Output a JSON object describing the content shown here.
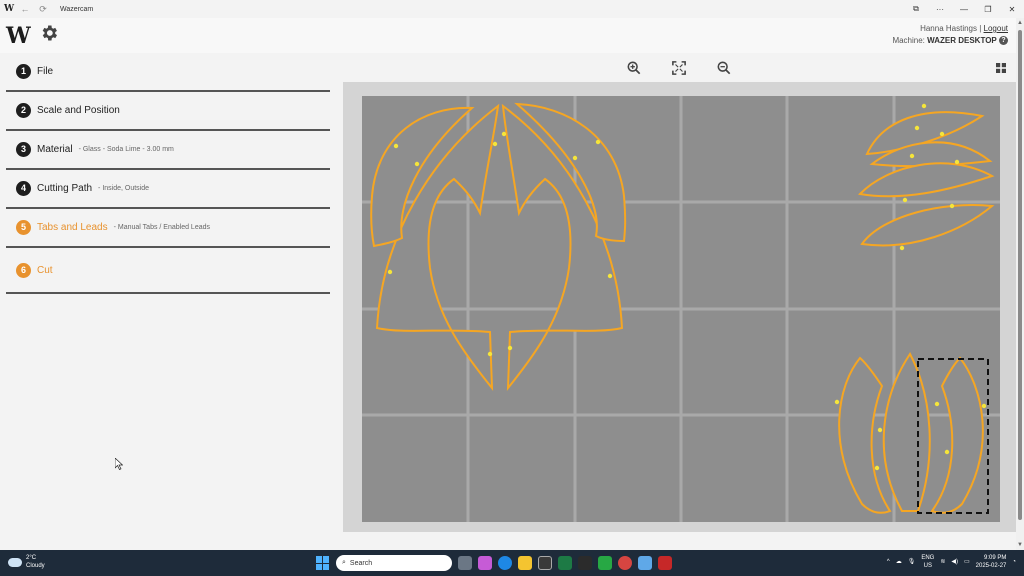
{
  "window": {
    "title": "Wazercam",
    "controls": [
      "⧉",
      "···",
      "—",
      "❐",
      "✕"
    ]
  },
  "header": {
    "logo": "W",
    "user_name": "Hanna Hastings",
    "separator": " | ",
    "logout": "Logout",
    "machine_label": "Machine: ",
    "machine_name": "WAZER DESKTOP",
    "help": "?"
  },
  "steps": [
    {
      "num": "1",
      "label": "File",
      "detail": ""
    },
    {
      "num": "2",
      "label": "Scale and Position",
      "detail": ""
    },
    {
      "num": "3",
      "label": "Material",
      "detail": "- Glass - Soda Lime - 3.00 mm"
    },
    {
      "num": "4",
      "label": "Cutting Path",
      "detail": "- Inside, Outside"
    },
    {
      "num": "5",
      "label": "Tabs and Leads",
      "detail": "- Manual Tabs / Enabled Leads"
    },
    {
      "num": "6",
      "label": "Cut",
      "detail": ""
    }
  ],
  "colors": {
    "accent": "#e8922e",
    "path": "#f5a623",
    "tab_point": "#f5e53a",
    "bed": "#8e8e8e",
    "grid": "#a6a6a6"
  },
  "taskbar": {
    "weather_temp": "2°C",
    "weather_desc": "Cloudy",
    "search_placeholder": "Search",
    "lang": "ENG",
    "region": "US",
    "time": "9:09 PM",
    "date": "2025-02-27"
  }
}
